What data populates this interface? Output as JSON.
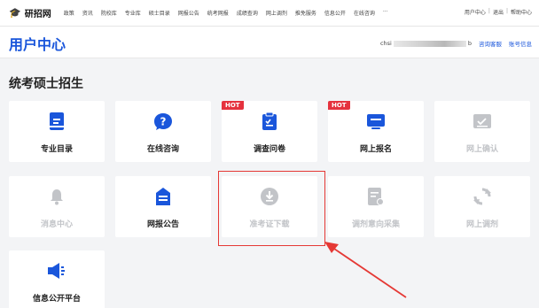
{
  "topnav": {
    "logo": "研招网",
    "items": [
      "政策",
      "资讯",
      "院校库",
      "专业库",
      "硕士目录",
      "网报公告",
      "统考网报",
      "成绩查询",
      "网上调剂",
      "推免服务",
      "信息公开",
      "在线咨询",
      "···"
    ],
    "links": [
      "用户中心",
      "退出",
      "帮助中心"
    ]
  },
  "header": {
    "title": "用户中心",
    "user_prefix": "chsi",
    "user_suffix": "b",
    "links": [
      "咨询客服",
      "账号信息"
    ]
  },
  "section_title": "统考硕士招生",
  "tiles": [
    {
      "label": "专业目录",
      "icon": "book-icon",
      "enabled": true
    },
    {
      "label": "在线咨询",
      "icon": "chat-question-icon",
      "enabled": true
    },
    {
      "label": "调查问卷",
      "icon": "clipboard-check-icon",
      "enabled": true,
      "badge": "HOT"
    },
    {
      "label": "网上报名",
      "icon": "monitor-icon",
      "enabled": true,
      "badge": "HOT"
    },
    {
      "label": "网上确认",
      "icon": "id-card-check-icon",
      "enabled": false
    },
    {
      "label": "消息中心",
      "icon": "bell-icon",
      "enabled": false
    },
    {
      "label": "网报公告",
      "icon": "briefcase-icon",
      "enabled": true
    },
    {
      "label": "准考证下载",
      "icon": "download-icon",
      "enabled": false
    },
    {
      "label": "调剂意向采集",
      "icon": "form-edit-icon",
      "enabled": false
    },
    {
      "label": "网上调剂",
      "icon": "refresh-icon",
      "enabled": false
    },
    {
      "label": "信息公开平台",
      "icon": "megaphone-icon",
      "enabled": true
    }
  ],
  "colors": {
    "primary": "#1a56db",
    "disabled": "#c2c4c8",
    "hot": "#e5323e",
    "annotation": "#e53935"
  }
}
